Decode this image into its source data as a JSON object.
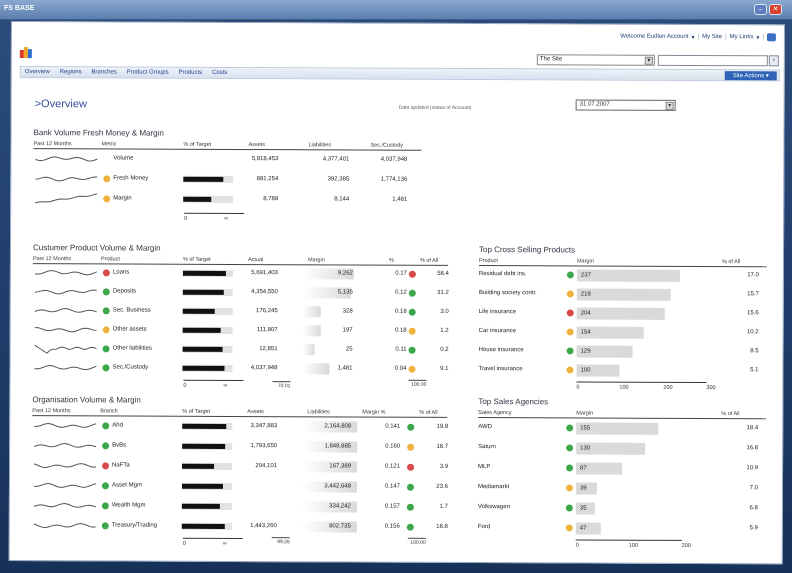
{
  "app": {
    "title": "FS BASE"
  },
  "userbar": {
    "welcome": "Welcome Eudlen Account",
    "mysite": "My Site",
    "mylinks": "My Links"
  },
  "site_select": "The Site",
  "nav": {
    "tabs": [
      "Overview",
      "Regions",
      "Branches",
      "Product Groups",
      "Products",
      "Costs"
    ],
    "site_actions": "Site Actions"
  },
  "page": {
    "title": ">Overview",
    "data_label": "Data updated (status of Account)",
    "date": "31.07.2007"
  },
  "bank": {
    "title": "Bank Volume Fresh Money & Margin",
    "headers": [
      "Past 12 Months",
      "Metric",
      "% of Target",
      "Assets",
      "Liabilities",
      "Sec./Custody"
    ],
    "rows": [
      {
        "metric": "Volume",
        "assets": "5,818,453",
        "liab": "4,377,401",
        "sec": "4,037,948",
        "dot": "",
        "target": 0
      },
      {
        "metric": "Fresh Money",
        "assets": "881,254",
        "liab": "392,385",
        "sec": "1,774,136",
        "dot": "o",
        "target": 0.88
      },
      {
        "metric": "Margin",
        "assets": "8,788",
        "liab": "8,144",
        "sec": "1,481",
        "dot": "o",
        "target": 0.62
      }
    ],
    "axis": [
      "0",
      "∞"
    ]
  },
  "customer": {
    "title": "Custumer Product Volume & Margin",
    "headers": [
      "Past 12 Months",
      "Product",
      "% of Target",
      "Actual",
      "Margin",
      "%",
      "% of All"
    ],
    "rows": [
      {
        "product": "Loans",
        "actual": "5,691,403",
        "margin": "9,262",
        "pct": "0.17",
        "all": "58.4",
        "dot": "r",
        "pdot": "r",
        "target": 0.95,
        "mfill": 0.85
      },
      {
        "product": "Deposits",
        "actual": "4,354,550",
        "margin": "5,135",
        "pct": "0.12",
        "all": "31.2",
        "dot": "g",
        "pdot": "g",
        "target": 0.9,
        "mfill": 0.8
      },
      {
        "product": "Sec. Business",
        "actual": "176,245",
        "margin": "328",
        "pct": "0.18",
        "all": "3.0",
        "dot": "g",
        "pdot": "g",
        "target": 0.72,
        "mfill": 0.3
      },
      {
        "product": "Other assets",
        "actual": "111,807",
        "margin": "197",
        "pct": "0.18",
        "all": "1.2",
        "dot": "o",
        "pdot": "o",
        "target": 0.85,
        "mfill": 0.3
      },
      {
        "product": "Other liabilities",
        "actual": "12,851",
        "margin": "25",
        "pct": "0.11",
        "all": "0.2",
        "dot": "g",
        "pdot": "g",
        "target": 0.88,
        "mfill": 0.2
      },
      {
        "product": "Sec./Custody",
        "actual": "4,037,948",
        "margin": "1,481",
        "pct": "0.04",
        "all": "9.1",
        "dot": "g",
        "pdot": "o",
        "target": 0.94,
        "mfill": 0.45
      }
    ],
    "total": "100.00",
    "axis": [
      "0",
      "∞"
    ]
  },
  "org": {
    "title": "Organisation Volume & Margin",
    "headers": [
      "Past 12 Months",
      "Branch",
      "% of Target",
      "Assets",
      "Liabilities",
      "Margin %",
      "% of All"
    ],
    "rows": [
      {
        "branch": "Ahd",
        "assets": "3,347,883",
        "liab": "2,164,808",
        "margin": "0.141",
        "all": "19.8",
        "dot": "g",
        "pdot": "g",
        "target": 0.98
      },
      {
        "branch": "BvBs",
        "assets": "1,793,650",
        "liab": "1,848,885",
        "margin": "0.160",
        "all": "18.7",
        "dot": "g",
        "pdot": "o",
        "target": 0.95
      },
      {
        "branch": "NaFTa",
        "assets": "204,101",
        "liab": "167,389",
        "margin": "0.121",
        "all": "3.9",
        "dot": "r",
        "pdot": "r",
        "target": 0.7
      },
      {
        "branch": "Asset Mgm",
        "assets": "",
        "liab": "3,442,648",
        "margin": "0.147",
        "all": "23.6",
        "dot": "g",
        "pdot": "g",
        "target": 0.9
      },
      {
        "branch": "Wealth Mgm",
        "assets": "",
        "liab": "334,242",
        "margin": "0.157",
        "all": "1.7",
        "dot": "g",
        "pdot": "g",
        "target": 0.85
      },
      {
        "branch": "Treasury/Trading",
        "assets": "1,443,260",
        "liab": "802,735",
        "margin": "0.156",
        "all": "18.8",
        "dot": "g",
        "pdot": "g",
        "target": 0.96
      }
    ],
    "total": "100.00",
    "axis": [
      "0",
      "∞"
    ]
  },
  "cross": {
    "title": "Top Cross Selling Products",
    "headers": [
      "Product",
      "Margin",
      "% of All"
    ],
    "rows": [
      {
        "product": "Residual debt ins.",
        "margin": "237",
        "all": "17.0",
        "dot": "g",
        "value": 237
      },
      {
        "product": "Building society contr.",
        "margin": "218",
        "all": "15.7",
        "dot": "o",
        "value": 218
      },
      {
        "product": "Life insurance",
        "margin": "204",
        "all": "15.6",
        "dot": "r",
        "value": 204
      },
      {
        "product": "Car insurance",
        "margin": "154",
        "all": "10.2",
        "dot": "o",
        "value": 154
      },
      {
        "product": "House insurance",
        "margin": "129",
        "all": "8.5",
        "dot": "g",
        "value": 129
      },
      {
        "product": "Travel insurance",
        "margin": "100",
        "all": "5.1",
        "dot": "o",
        "value": 100
      }
    ],
    "total": "70.01",
    "axis": [
      "0",
      "100",
      "200",
      "300"
    ]
  },
  "agencies": {
    "title": "Top Sales Agencies",
    "headers": [
      "Sales Agency",
      "Margin",
      "% of All"
    ],
    "rows": [
      {
        "agency": "AWD",
        "margin": "155",
        "all": "18.4",
        "dot": "g",
        "value": 155
      },
      {
        "agency": "Saturn",
        "margin": "130",
        "all": "16.8",
        "dot": "g",
        "value": 130
      },
      {
        "agency": "MLP",
        "margin": "87",
        "all": "10.9",
        "dot": "g",
        "value": 87
      },
      {
        "agency": "Mediamarkt",
        "margin": "39",
        "all": "7.0",
        "dot": "o",
        "value": 39
      },
      {
        "agency": "Volkswagen",
        "margin": "35",
        "all": "6.8",
        "dot": "g",
        "value": 35
      },
      {
        "agency": "Ford",
        "margin": "47",
        "all": "5.9",
        "dot": "o",
        "value": 47
      }
    ],
    "total": "99.26",
    "axis": [
      "0",
      "100",
      "200"
    ]
  }
}
